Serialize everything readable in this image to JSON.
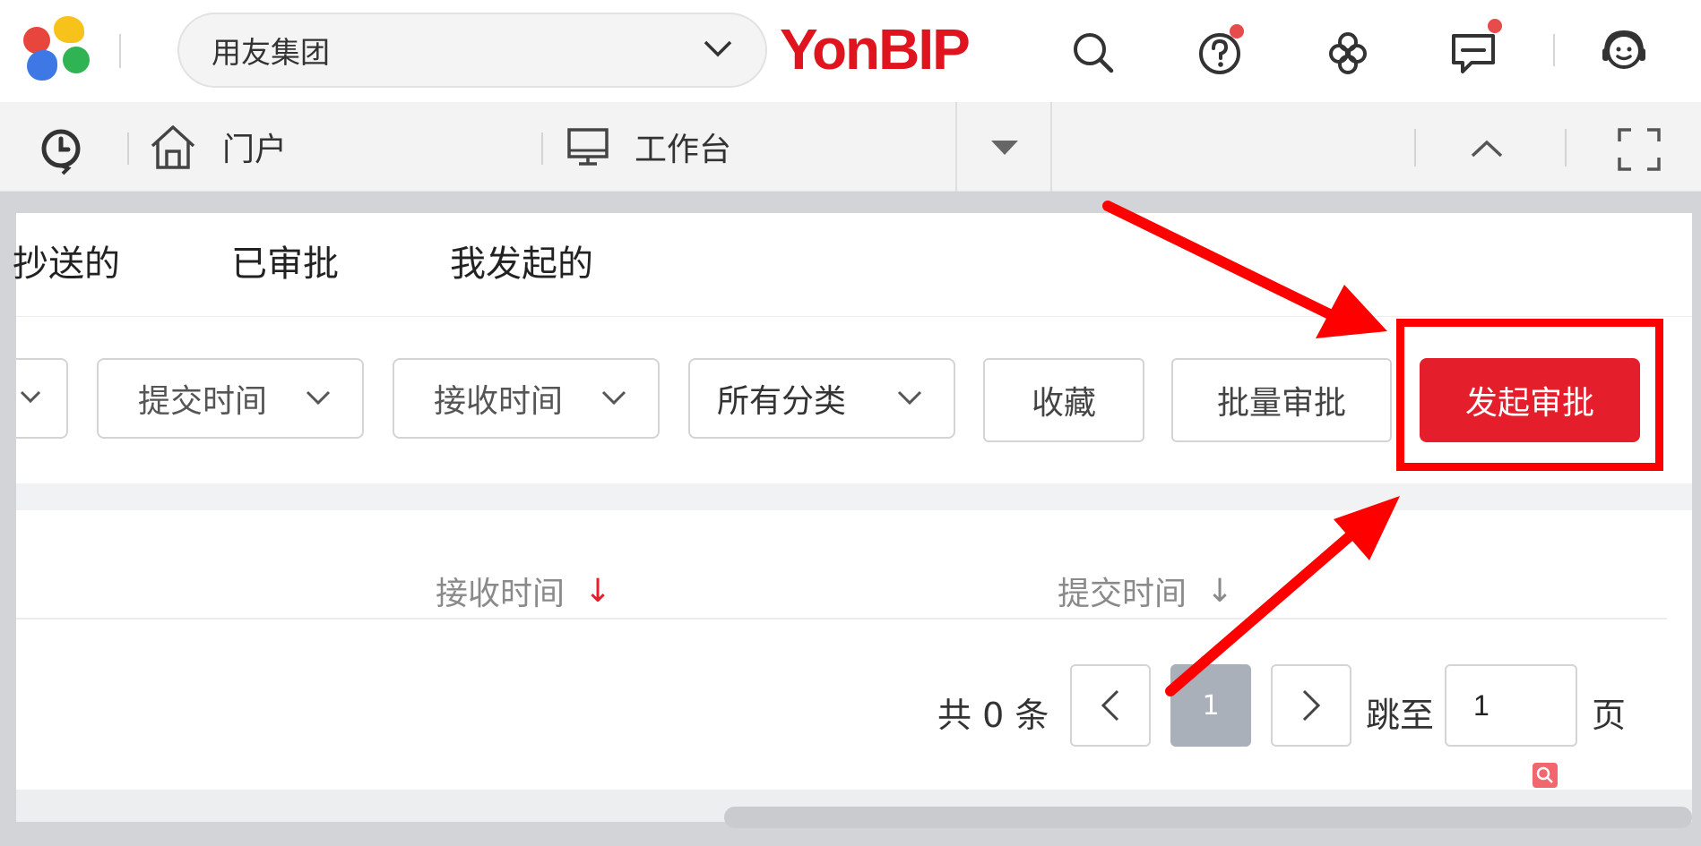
{
  "header": {
    "org_select": {
      "value": "用友集团"
    },
    "brand": "YonBIP",
    "icons": [
      "search-icon",
      "help-icon",
      "apps-icon",
      "message-icon",
      "customer-service-icon"
    ]
  },
  "tabbar": {
    "tabs": [
      {
        "label": "门户",
        "icon": "home-icon"
      },
      {
        "label": "工作台",
        "icon": "monitor-icon"
      }
    ]
  },
  "subtabs": [
    "抄送的",
    "已审批",
    "我发起的"
  ],
  "filters": [
    {
      "label": "提交时间"
    },
    {
      "label": "接收时间"
    },
    {
      "label": "所有分类"
    }
  ],
  "buttons": {
    "favorite": "收藏",
    "batch_approve": "批量审批",
    "start_approval": "发起审批"
  },
  "table": {
    "columns": [
      {
        "label": "接收时间",
        "sort": "desc",
        "sort_color": "#e41e2b",
        "arrow": "↓"
      },
      {
        "label": "提交时间",
        "sort": "none",
        "sort_color": "#8a8a8a",
        "arrow": "↓"
      }
    ]
  },
  "pagination": {
    "total_prefix": "共",
    "total": "0",
    "total_suffix": "条",
    "current_page": "1",
    "jump_label": "跳至",
    "jump_value": "1",
    "page_suffix": "页"
  },
  "colors": {
    "accent": "#e41e2b",
    "annotation": "#ff0000"
  }
}
